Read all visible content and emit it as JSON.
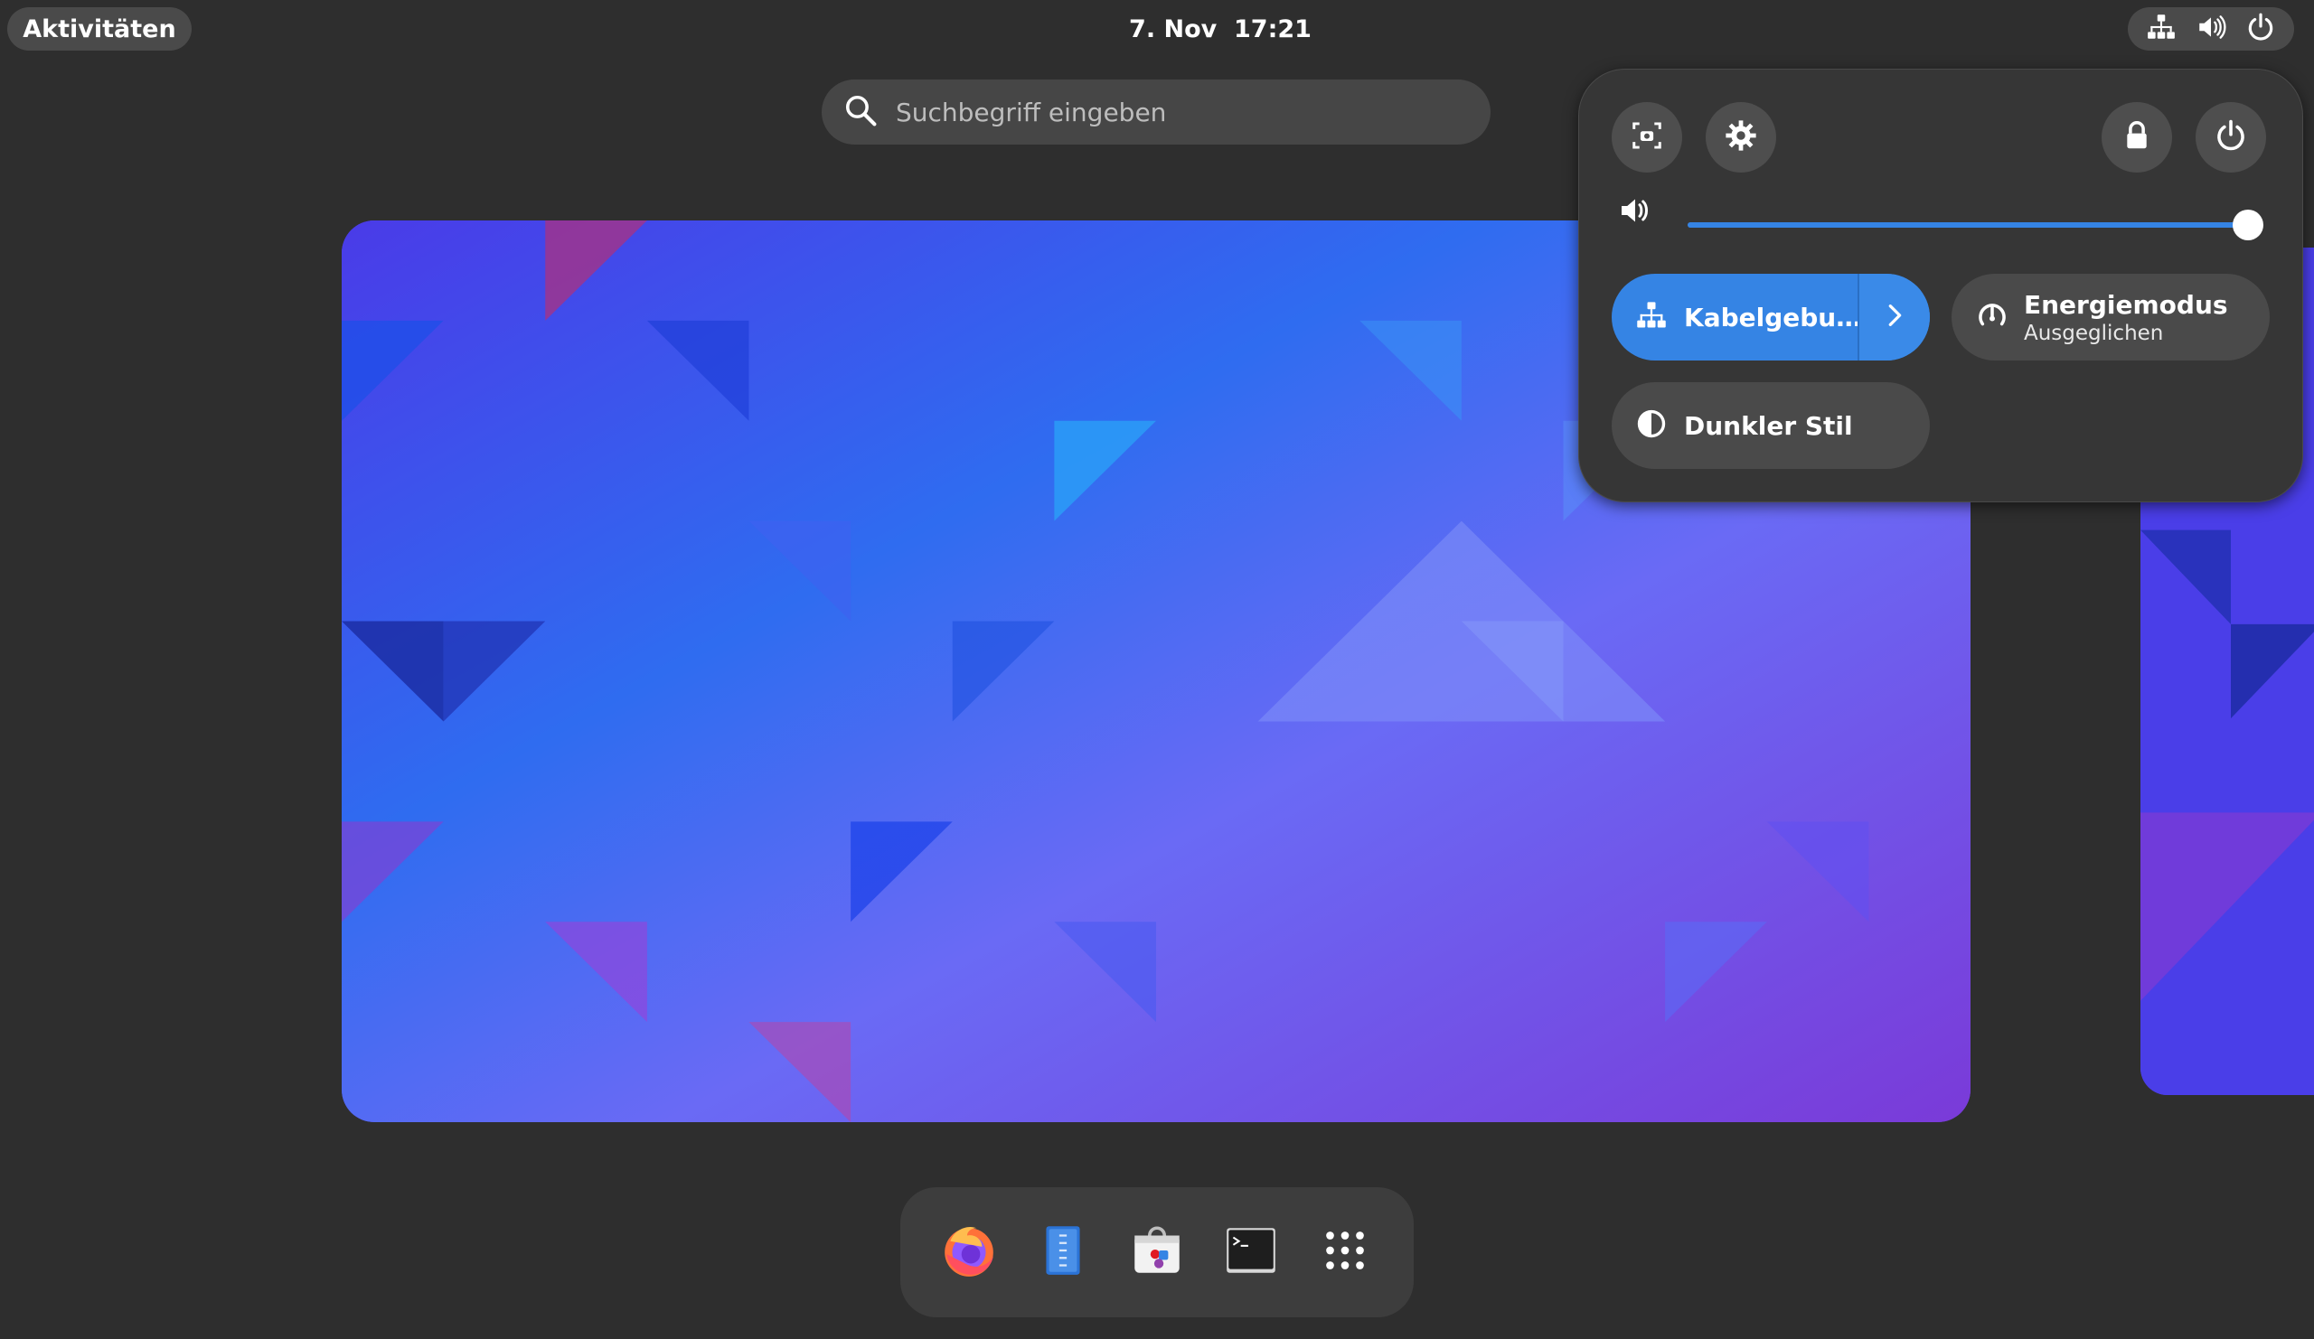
{
  "topbar": {
    "activities_label": "Aktivitäten",
    "clock": "7. Nov  17:21",
    "tray_icons": [
      "network-wired-icon",
      "volume-icon",
      "power-icon"
    ]
  },
  "search": {
    "placeholder": "Suchbegriff eingeben",
    "icon": "search-icon"
  },
  "quick_settings": {
    "top_buttons": [
      "screenshot-icon",
      "settings-gear-icon",
      "lock-icon",
      "power-icon"
    ],
    "volume": {
      "icon": "volume-icon",
      "level_percent": 100
    },
    "toggles": {
      "network": {
        "label": "Kabelgebu…",
        "icon": "network-wired-icon",
        "active": true
      },
      "power_mode": {
        "label": "Energiemodus",
        "sublabel": "Ausgeglichen",
        "icon": "power-profile-icon"
      },
      "dark_style": {
        "label": "Dunkler Stil",
        "icon": "dark-style-icon"
      }
    }
  },
  "dash": {
    "apps": [
      "firefox-icon",
      "text-editor-icon",
      "software-store-icon",
      "terminal-icon",
      "show-apps-grid-icon"
    ]
  },
  "colors": {
    "accent": "#3584e4",
    "panel_bg": "#363636",
    "background": "#2e2e2e"
  }
}
